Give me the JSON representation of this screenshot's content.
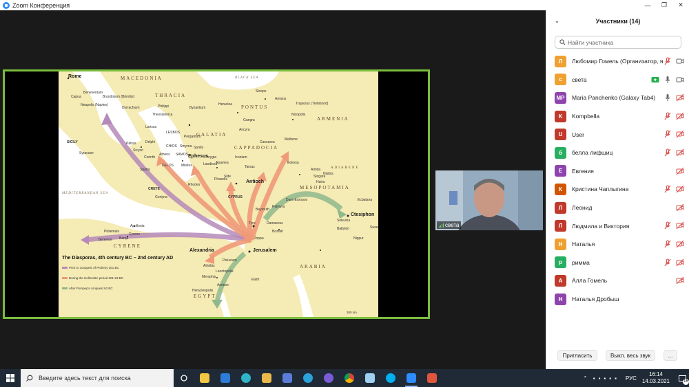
{
  "window": {
    "title": "Zoom Конференция",
    "controls": [
      "—",
      "❐",
      "✕"
    ]
  },
  "share": {
    "map": {
      "title": "The Diasporas, 4th century BC – 2nd century AD",
      "regions": [
        "MACEDONIA",
        "THRACIA",
        "PONTUS",
        "GALATIA",
        "CAPPADOCIA",
        "ARMENIA",
        "MESOPOTAMIA",
        "ADIABENE",
        "CYRENE",
        "ARABIA",
        "EGYPT"
      ],
      "seas": [
        "BLACK SEA",
        "MEDITERRANEAN SEA"
      ],
      "big_cities": [
        "Rome",
        "Ephesus",
        "Antioch",
        "Alexandria",
        "Jerusalem",
        "Ctesiphon"
      ],
      "cities": [
        "Capua",
        "Beneventum",
        "Neapolis (Naples)",
        "Brundisium (Brindisi)",
        "Dyrrachium",
        "Sinope",
        "Amisos",
        "Trapezus (Trebizond)",
        "Nicopolis",
        "Byzantium",
        "Heraclea",
        "Gangra",
        "Ancyra",
        "Philippi",
        "Thessalonica",
        "Larissa",
        "Delphi",
        "Corinth",
        "Athens",
        "Sparta",
        "Sicyon",
        "Patras",
        "Syracuse",
        "Pergamum",
        "Sardis",
        "Smyrna",
        "Miletus",
        "Laodicea",
        "Phrygia",
        "Apamea",
        "Tarsus",
        "Side",
        "Phaselis",
        "Rhodes",
        "Caesarea",
        "Melitene",
        "Iconium",
        "Edessa",
        "Nisibis",
        "Singara",
        "Hatra",
        "Ecbatana",
        "Dura-Europos",
        "Palmyra",
        "Damascus",
        "Tyre",
        "Beyrouth",
        "Bozrah",
        "Joppa",
        "Pelusium",
        "Memphis",
        "Heracleopolis",
        "Leontopolis",
        "Athribis",
        "Arsinoe",
        "Elath",
        "Apollonia",
        "Cyrene",
        "Barqa",
        "Ptolemais",
        "Berenice",
        "Gortyna",
        "Babylon",
        "Seleucia",
        "Nippur",
        "Susa",
        "Amida"
      ],
      "labels_misc": [
        "SICILY",
        "CRETE",
        "CYPRUS",
        "LESBOS",
        "CHIOS",
        "SAMOS",
        "DELOS"
      ],
      "legend": [
        "Prior to conquest of Ptolemy 301 BC",
        "During the Hellenistic period 301-63 BC",
        "After Pompey's conquest 63 BC"
      ],
      "scale": "300 km."
    }
  },
  "video": {
    "name": "света"
  },
  "panel": {
    "header": "Участники (14)",
    "search_placeholder": "Найти участника",
    "participants": [
      {
        "initial": "Л",
        "name": "Любомир Гомель (Организатор, я)",
        "color": "#f0a030",
        "mic": "muted",
        "cam": "on"
      },
      {
        "initial": "с",
        "name": "света",
        "color": "#f0a030",
        "mic": "on",
        "cam": "on",
        "share": true
      },
      {
        "initial": "MP",
        "name": "Maria Panchenko (Galaxy Tab4)",
        "color": "#8e44ad",
        "mic": "on",
        "cam": "off"
      },
      {
        "initial": "K",
        "name": "Kompbella",
        "color": "#c0392b",
        "mic": "muted",
        "cam": "off"
      },
      {
        "initial": "U",
        "name": "User",
        "color": "#c0392b",
        "mic": "muted",
        "cam": "off"
      },
      {
        "initial": "б",
        "name": "белла лифшиц",
        "color": "#27ae60",
        "mic": "muted",
        "cam": "off"
      },
      {
        "initial": "Е",
        "name": "Евгения",
        "color": "#8e44ad",
        "mic": "none",
        "cam": "off"
      },
      {
        "initial": "К",
        "name": "Кристина Чаплыгина",
        "color": "#d35400",
        "mic": "muted",
        "cam": "off"
      },
      {
        "initial": "Л",
        "name": "Леонид",
        "color": "#c0392b",
        "mic": "none",
        "cam": "off"
      },
      {
        "initial": "Л",
        "name": "Людмила и Виктория",
        "color": "#c0392b",
        "mic": "muted",
        "cam": "off"
      },
      {
        "initial": "Н",
        "name": "Наталья",
        "color": "#f0a030",
        "mic": "muted",
        "cam": "off"
      },
      {
        "initial": "р",
        "name": "римма",
        "color": "#27ae60",
        "mic": "muted",
        "cam": "off"
      },
      {
        "initial": "А",
        "name": "Алла Гомель",
        "color": "#c0392b",
        "mic": "none",
        "cam": "off"
      },
      {
        "initial": "Н",
        "name": "Наталья Дробыш",
        "color": "#8e44ad",
        "mic": "none",
        "cam": "none"
      }
    ],
    "footer": {
      "invite": "Пригласить",
      "mute_all": "Выкл. весь звук",
      "more": "..."
    }
  },
  "taskbar": {
    "search_placeholder": "Введите здесь текст для поиска",
    "lang": "РУС",
    "time": "16:14",
    "date": "14.03.2021",
    "notifications": "15",
    "apps": [
      "task-view",
      "explorer",
      "mail",
      "edge",
      "folder",
      "store",
      "telegram",
      "viber",
      "chrome",
      "notepad",
      "skype",
      "zoom",
      "app-red"
    ]
  }
}
